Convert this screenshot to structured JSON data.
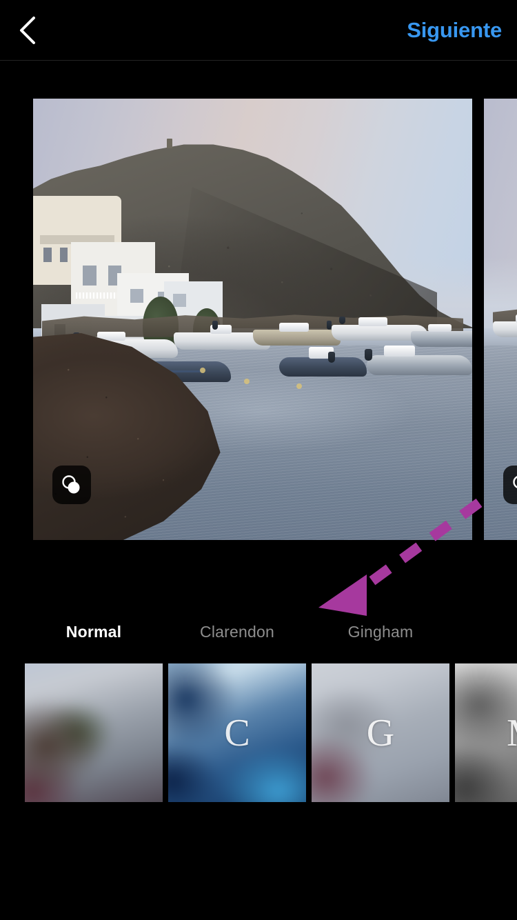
{
  "header": {
    "back_icon": "chevron-left-icon",
    "next_label": "Siguiente",
    "next_color": "#3897F0"
  },
  "carousel": {
    "badge_icon": "carousel-multiple-photos-icon",
    "slides": [
      {
        "alt": "Coastal harbour at dusk with moored boats below a rocky headland and white village houses",
        "has_badge": true
      },
      {
        "alt": "Second photo in carousel, partially visible",
        "has_badge": true
      }
    ]
  },
  "annotation": {
    "type": "dashed-arrow",
    "color": "#A6399E",
    "direction": "down-left"
  },
  "filters": {
    "selected": "Normal",
    "items": [
      {
        "label": "Normal",
        "letter": "",
        "active": true
      },
      {
        "label": "Clarendon",
        "letter": "C",
        "active": false
      },
      {
        "label": "Gingham",
        "letter": "G",
        "active": false
      },
      {
        "label": "M",
        "letter": "M",
        "active": false
      }
    ]
  },
  "colors": {
    "background": "#000000",
    "accent": "#3897F0",
    "label_inactive": "#8E8E8E",
    "label_active": "#FFFFFF",
    "divider": "#232323"
  }
}
